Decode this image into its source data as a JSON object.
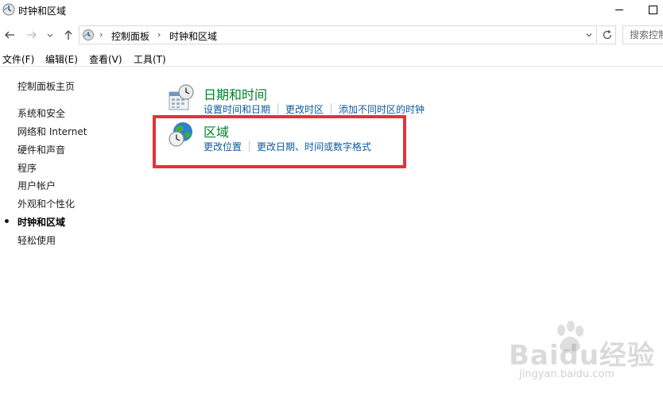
{
  "window": {
    "title": "时钟和区域"
  },
  "address": {
    "breadcrumbs": [
      "控制面板",
      "时钟和区域"
    ],
    "search_placeholder": "搜索控制面板"
  },
  "menubar": {
    "items": [
      "文件(F)",
      "编辑(E)",
      "查看(V)",
      "工具(T)"
    ]
  },
  "leftnav": {
    "home": "控制面板主页",
    "items": [
      {
        "label": "系统和安全",
        "active": false
      },
      {
        "label": "网络和 Internet",
        "active": false
      },
      {
        "label": "硬件和声音",
        "active": false
      },
      {
        "label": "程序",
        "active": false
      },
      {
        "label": "用户帐户",
        "active": false
      },
      {
        "label": "外观和个性化",
        "active": false
      },
      {
        "label": "时钟和区域",
        "active": true
      },
      {
        "label": "轻松使用",
        "active": false
      }
    ]
  },
  "categories": [
    {
      "title": "日期和时间",
      "icon": "calendar-clock-icon",
      "links": [
        "设置时间和日期",
        "更改时区",
        "添加不同时区的时钟"
      ]
    },
    {
      "title": "区域",
      "icon": "globe-clock-icon",
      "links": [
        "更改位置",
        "更改日期、时间或数字格式"
      ]
    }
  ],
  "watermark": {
    "logo": "Baidu经验",
    "url": "jingyan.baidu.com"
  },
  "colors": {
    "category_title": "#00802c",
    "link": "#0c5aa0",
    "highlight": "#e53238"
  }
}
